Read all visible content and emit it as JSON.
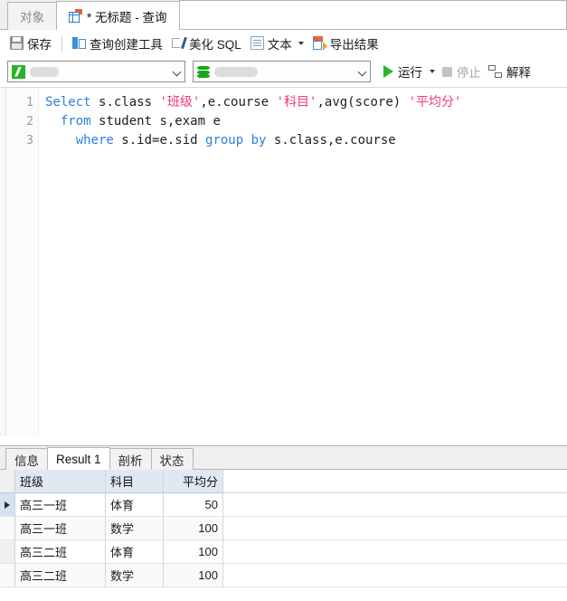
{
  "window": {
    "tabs": [
      {
        "label": "对象",
        "icon": null,
        "active": false
      },
      {
        "label": "* 无标题 - 查询",
        "icon": "query-document-icon",
        "active": true
      }
    ]
  },
  "toolbar": {
    "items": [
      {
        "label": "保存",
        "icon": "save-icon"
      },
      {
        "label": "查询创建工具",
        "icon": "query-builder-icon"
      },
      {
        "label": "美化 SQL",
        "icon": "beautify-sql-icon"
      },
      {
        "label": "文本",
        "icon": "text-icon",
        "has_caret": true
      },
      {
        "label": "导出结果",
        "icon": "export-result-icon"
      }
    ]
  },
  "connection_bar": {
    "connection": {
      "value": "",
      "redacted": true,
      "icon": "connection-icon"
    },
    "database": {
      "value": "",
      "redacted": true,
      "icon": "database-icon"
    },
    "run_label": "运行",
    "stop_label": "停止",
    "explain_label": "解释"
  },
  "editor": {
    "line_numbers": [
      "1",
      "2",
      "3"
    ],
    "lines": [
      [
        {
          "t": "Select ",
          "c": "kw"
        },
        {
          "t": "s.class ",
          "c": "fn"
        },
        {
          "t": "'班级'",
          "c": "str"
        },
        {
          "t": ",e.course ",
          "c": "fn"
        },
        {
          "t": "'科目'",
          "c": "str"
        },
        {
          "t": ",avg(score) ",
          "c": "fn"
        },
        {
          "t": "'平均分'",
          "c": "str"
        }
      ],
      [
        {
          "t": "  ",
          "c": "fn"
        },
        {
          "t": "from ",
          "c": "kw"
        },
        {
          "t": "student s,exam e",
          "c": "fn"
        }
      ],
      [
        {
          "t": "    ",
          "c": "fn"
        },
        {
          "t": "where ",
          "c": "kw"
        },
        {
          "t": "s.id=e.sid ",
          "c": "fn"
        },
        {
          "t": "group by ",
          "c": "kw"
        },
        {
          "t": "s.class,e.course",
          "c": "fn"
        }
      ]
    ]
  },
  "results": {
    "tabs": [
      {
        "label": "信息",
        "active": false
      },
      {
        "label": "Result 1",
        "active": true
      },
      {
        "label": "剖析",
        "active": false
      },
      {
        "label": "状态",
        "active": false
      }
    ],
    "grid": {
      "columns": [
        "班级",
        "科目",
        "平均分"
      ],
      "rows": [
        {
          "cells": [
            "高三一班",
            "体育",
            "50"
          ],
          "selected": true
        },
        {
          "cells": [
            "高三一班",
            "数学",
            "100"
          ],
          "selected": false
        },
        {
          "cells": [
            "高三二班",
            "体育",
            "100"
          ],
          "selected": false
        },
        {
          "cells": [
            "高三二班",
            "数学",
            "100"
          ],
          "selected": false
        }
      ]
    }
  },
  "colors": {
    "keyword": "#2b7fe0",
    "string": "#ef3b6e",
    "run_green": "#2fae2f",
    "header_bg": "#dfe8f3",
    "selected_row": "#d4e2f2"
  }
}
